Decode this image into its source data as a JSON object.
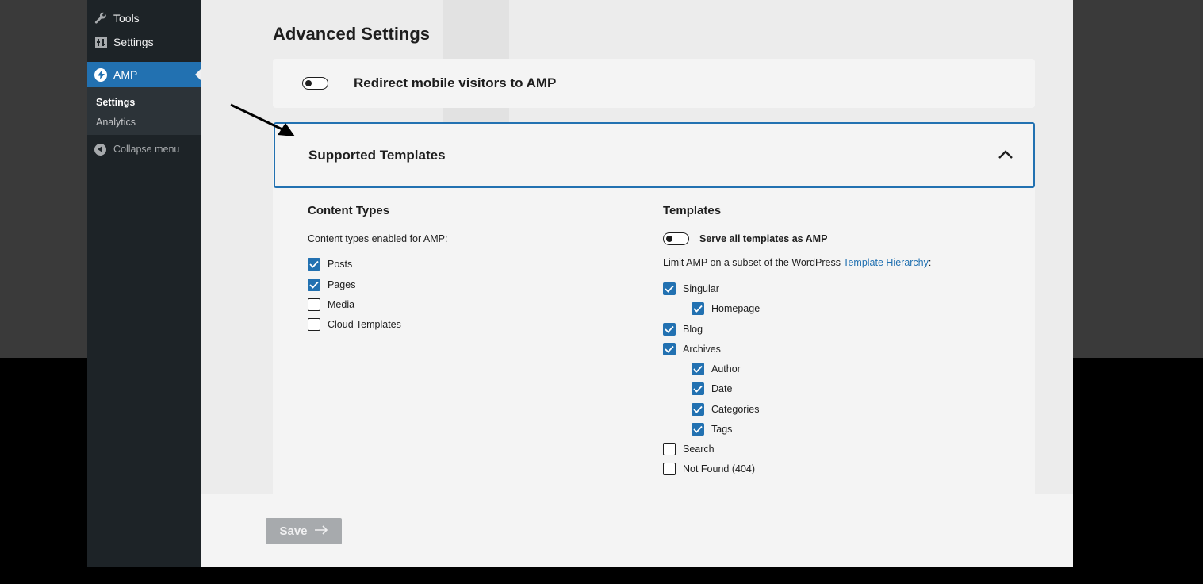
{
  "sidebar": {
    "tools_label": "Tools",
    "settings_label": "Settings",
    "amp_label": "AMP",
    "submenu": [
      {
        "label": "Settings",
        "current": true
      },
      {
        "label": "Analytics",
        "current": false
      }
    ],
    "collapse_label": "Collapse menu"
  },
  "main": {
    "heading": "Advanced Settings",
    "redirect": {
      "label": "Redirect mobile visitors to AMP",
      "enabled": false
    },
    "supported_templates": {
      "title": "Supported Templates",
      "content_types": {
        "title": "Content Types",
        "description": "Content types enabled for AMP:",
        "items": [
          {
            "label": "Posts",
            "checked": true
          },
          {
            "label": "Pages",
            "checked": true
          },
          {
            "label": "Media",
            "checked": false
          },
          {
            "label": "Cloud Templates",
            "checked": false
          }
        ]
      },
      "templates": {
        "title": "Templates",
        "serve_all_label": "Serve all templates as AMP",
        "serve_all_enabled": false,
        "description_prefix": "Limit AMP on a subset of the WordPress ",
        "description_link": "Template Hierarchy",
        "description_suffix": ":",
        "items": [
          {
            "label": "Singular",
            "checked": true,
            "level": 0
          },
          {
            "label": "Homepage",
            "checked": true,
            "level": 1
          },
          {
            "label": "Blog",
            "checked": true,
            "level": 0
          },
          {
            "label": "Archives",
            "checked": true,
            "level": 0
          },
          {
            "label": "Author",
            "checked": true,
            "level": 1
          },
          {
            "label": "Date",
            "checked": true,
            "level": 1
          },
          {
            "label": "Categories",
            "checked": true,
            "level": 1
          },
          {
            "label": "Tags",
            "checked": true,
            "level": 1
          },
          {
            "label": "Search",
            "checked": false,
            "level": 0
          },
          {
            "label": "Not Found (404)",
            "checked": false,
            "level": 0
          }
        ]
      }
    }
  },
  "footer": {
    "save_label": "Save",
    "save_arrow": "→"
  },
  "colors": {
    "accent": "#2271b1",
    "sidebar": "#1d2327",
    "disabled_button": "#a7aaad"
  },
  "icons": [
    "wrench-icon",
    "settings-icon",
    "amp-bolt-icon",
    "collapse-icon",
    "chevron-up-icon",
    "arrow-right-icon",
    "annotation-arrow"
  ]
}
